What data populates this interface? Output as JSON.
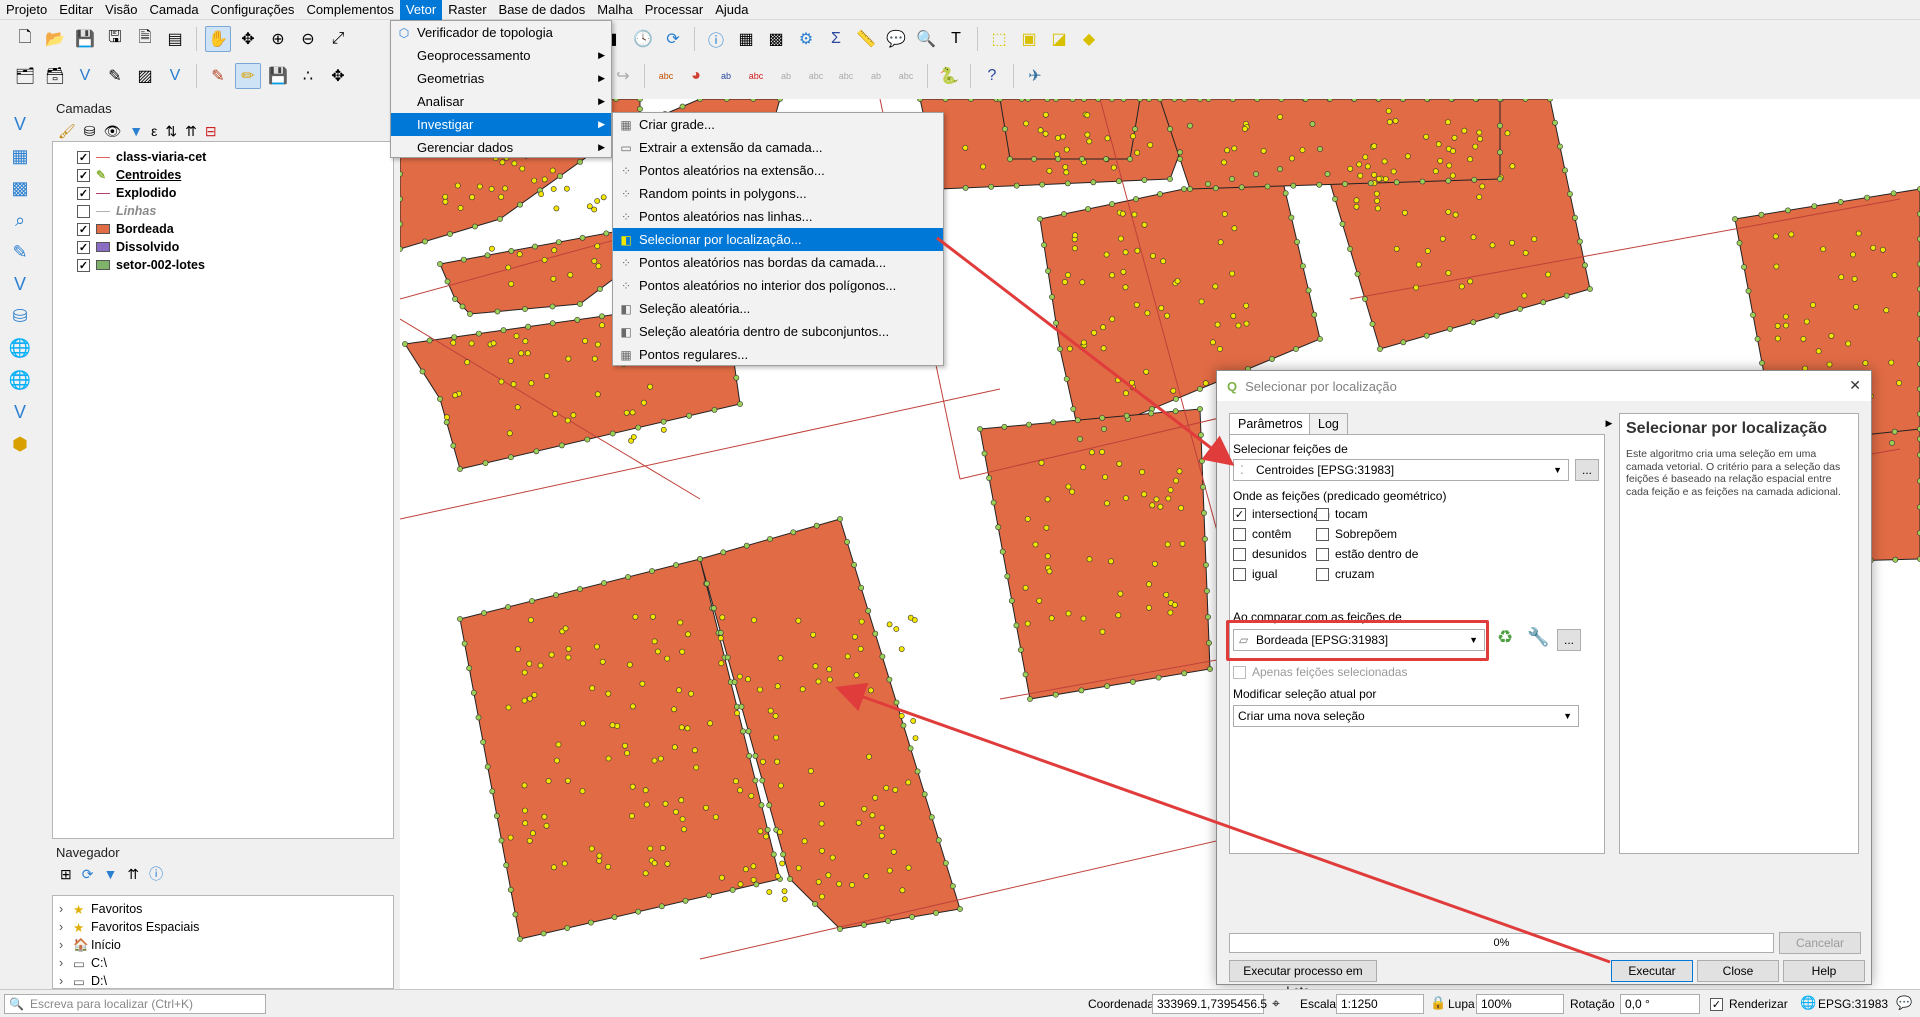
{
  "menubar": {
    "items": [
      "Projeto",
      "Editar",
      "Visão",
      "Camada",
      "Configurações",
      "Complementos",
      "Vetor",
      "Raster",
      "Base de dados",
      "Malha",
      "Processar",
      "Ajuda"
    ],
    "active": "Vetor"
  },
  "vetor_menu": {
    "items": [
      {
        "label": "Verificador de topologia",
        "submenu": false,
        "icon": "topology-icon"
      },
      {
        "label": "Geoprocessamento",
        "submenu": true
      },
      {
        "label": "Geometrias",
        "submenu": true
      },
      {
        "label": "Analisar",
        "submenu": true
      },
      {
        "label": "Investigar",
        "submenu": true,
        "highlighted": true
      },
      {
        "label": "Gerenciar dados",
        "submenu": true
      }
    ]
  },
  "investigar_menu": {
    "items": [
      {
        "label": "Criar grade...",
        "icon": "grid-icon"
      },
      {
        "label": "Extrair a extensão da camada...",
        "icon": "extent-icon"
      },
      {
        "label": "Pontos aleatórios na extensão...",
        "icon": "random-points-icon"
      },
      {
        "label": "Random points in polygons...",
        "icon": "random-points-polygon-icon"
      },
      {
        "label": "Pontos aleatórios nas linhas...",
        "icon": "random-points-lines-icon"
      },
      {
        "label": "Selecionar por localização...",
        "icon": "select-location-icon",
        "highlighted": true
      },
      {
        "label": "Pontos aleatórios nas bordas da camada...",
        "icon": "random-points-border-icon"
      },
      {
        "label": "Pontos aleatórios no interior dos polígonos...",
        "icon": "random-points-inside-icon"
      },
      {
        "label": "Seleção aleatória...",
        "icon": "random-selection-icon"
      },
      {
        "label": "Seleção aleatória dentro de subconjuntos...",
        "icon": "random-subset-icon"
      },
      {
        "label": "Pontos regulares...",
        "icon": "regular-points-icon"
      }
    ]
  },
  "layers_panel": {
    "title": "Camadas",
    "layers": [
      {
        "name": "class-viaria-cet",
        "checked": true,
        "symbol": "line",
        "color": "#e06060",
        "bold": true,
        "italic": false
      },
      {
        "name": "Centroides",
        "checked": true,
        "symbol": "edit",
        "color": "#8cb43c",
        "bold": true,
        "underline": true
      },
      {
        "name": "Explodido",
        "checked": true,
        "symbol": "line",
        "color": "#b04070",
        "bold": true
      },
      {
        "name": "Linhas",
        "checked": false,
        "symbol": "line",
        "color": "#b0b0b0",
        "bold": true,
        "italic": true
      },
      {
        "name": "Bordeada",
        "checked": true,
        "symbol": "fill",
        "color": "#e26c45",
        "bold": true
      },
      {
        "name": "Dissolvido",
        "checked": true,
        "symbol": "fill",
        "color": "#8a6cc4",
        "bold": true
      },
      {
        "name": "setor-002-lotes",
        "checked": true,
        "symbol": "fill",
        "color": "#7fb26a",
        "bold": true
      }
    ]
  },
  "navigator_panel": {
    "title": "Navegador",
    "items": [
      {
        "label": "Favoritos",
        "icon": "star-icon"
      },
      {
        "label": "Favoritos Espaciais",
        "icon": "star-icon"
      },
      {
        "label": "Início",
        "icon": "folder-icon"
      },
      {
        "label": "C:\\",
        "icon": "drive-icon"
      },
      {
        "label": "D:\\",
        "icon": "drive-icon"
      }
    ]
  },
  "search": {
    "placeholder": "Escreva para localizar (Ctrl+K)"
  },
  "dialog": {
    "title": "Selecionar por localização",
    "tabs": [
      "Parâmetros",
      "Log"
    ],
    "select_features_label": "Selecionar feições de",
    "select_layer": "Centroides [EPSG:31983]",
    "predicate_label": "Onde as feições (predicado geométrico)",
    "predicates": [
      {
        "label": "intersectionam",
        "checked": true
      },
      {
        "label": "tocam",
        "checked": false
      },
      {
        "label": "contêm",
        "checked": false
      },
      {
        "label": "Sobrepõem",
        "checked": false
      },
      {
        "label": "desunidos",
        "checked": false
      },
      {
        "label": "estão dentro de",
        "checked": false
      },
      {
        "label": "igual",
        "checked": false
      },
      {
        "label": "cruzam",
        "checked": false
      }
    ],
    "compare_label": "Ao comparar com as feições de",
    "compare_layer": "Bordeada [EPSG:31983]",
    "only_selected_label": "Apenas feições selecionadas",
    "modify_label": "Modificar seleção atual por",
    "modify_value": "Criar uma nova seleção",
    "help_title": "Selecionar por localização",
    "help_text": "Este algoritmo cria uma seleção em uma camada vetorial. O critério para a seleção das feições é baseado na relação espacial entre cada feição e as feições na camada adicional.",
    "progress": "0%",
    "progress_fraction": 0,
    "cancel_label": "Cancelar",
    "batch_label": "Executar processo em Lote...",
    "run_label": "Executar",
    "close_label": "Close",
    "help_label": "Help",
    "browse_label": "..."
  },
  "statusbar": {
    "coord_label": "Coordenada",
    "coord_value": "333969.1,7395456.5",
    "scale_label": "Escala",
    "scale_value": "1:1250",
    "zoom_label": "Lupa",
    "zoom_value": "100%",
    "rotation_label": "Rotação",
    "rotation_value": "0,0 °",
    "render_label": "Renderizar",
    "crs": "EPSG:31983"
  },
  "colors": {
    "parcel_fill": "#e06b45",
    "parcel_stroke": "#222222",
    "line_color": "#c0403a",
    "centroid_fill": "#f2e600",
    "border_point": "#9ccf55",
    "accent": "#0078d7",
    "annotation_red": "#e03c3c"
  }
}
